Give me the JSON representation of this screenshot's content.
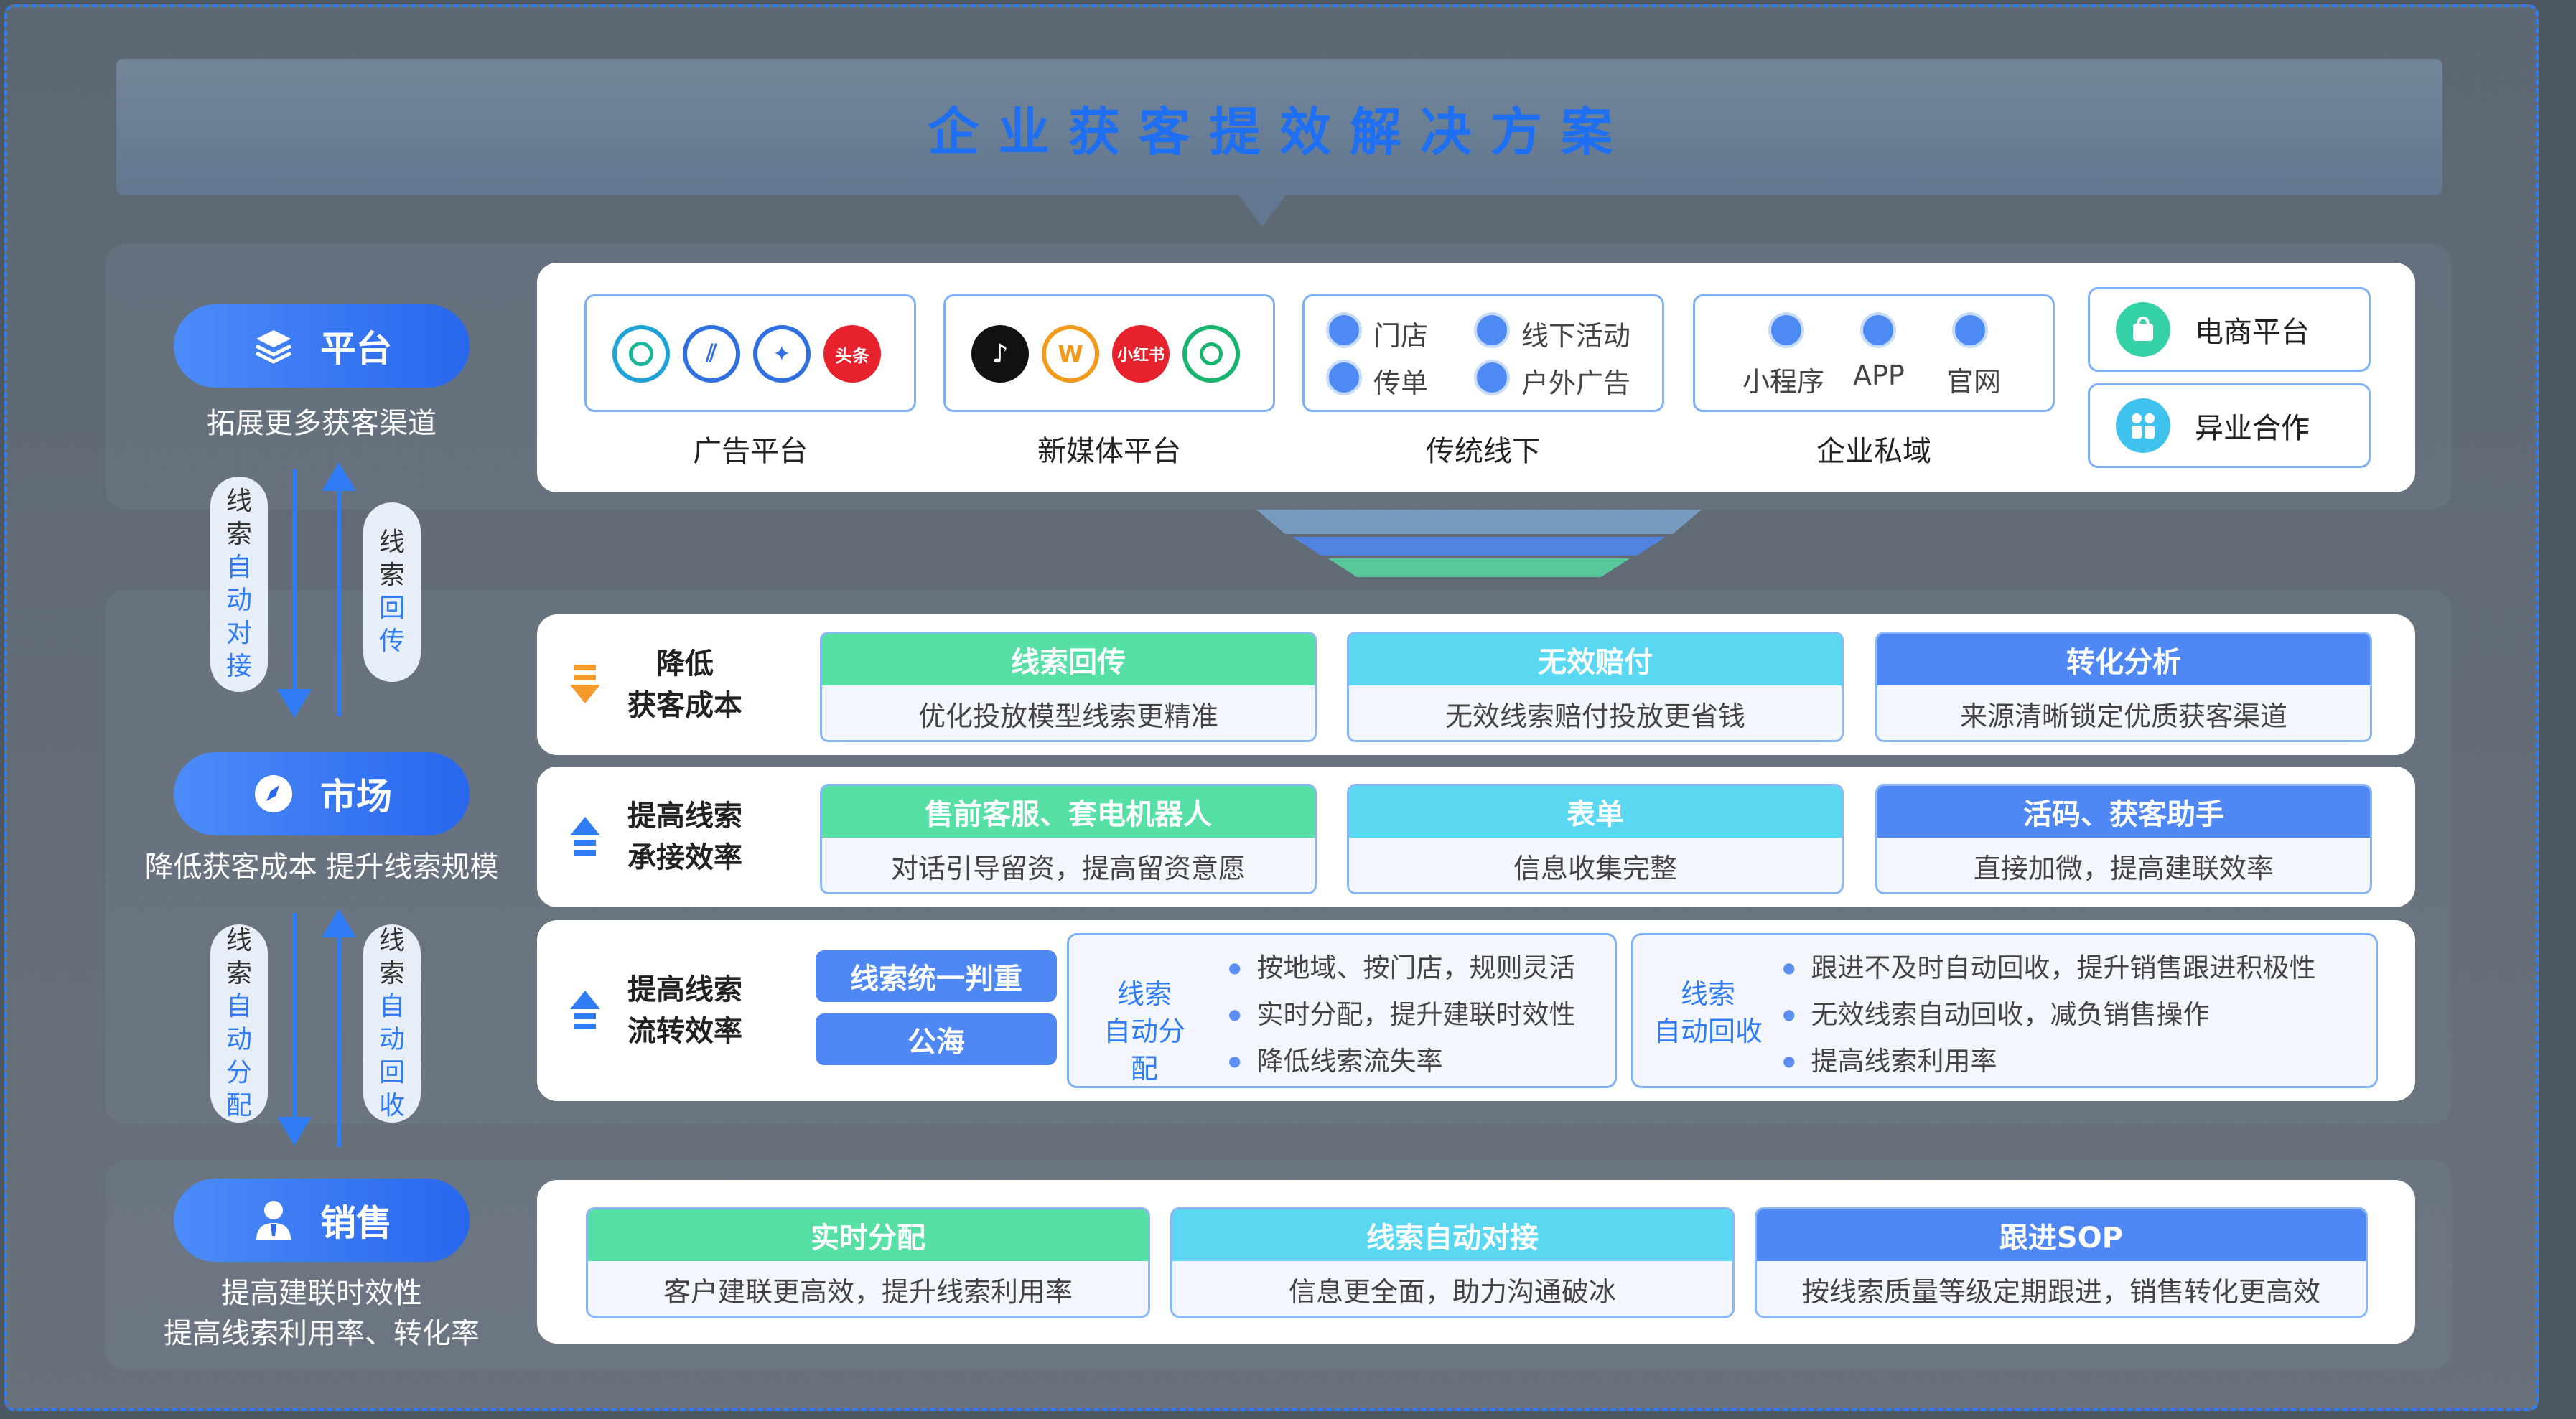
{
  "title": "企业获客提效解决方案",
  "stages": {
    "platform": {
      "label": "平台",
      "sub": "拓展更多获客渠道"
    },
    "market": {
      "label": "市场",
      "sub": "降低获客成本 提升线索规模"
    },
    "sales": {
      "label": "销售",
      "sub1": "提高建联时效性",
      "sub2": "提高线索利用率、转化率"
    }
  },
  "flows": {
    "f1": [
      "线",
      "索",
      "自",
      "动",
      "对",
      "接"
    ],
    "f2": [
      "线",
      "索",
      "回",
      "传"
    ],
    "f3": [
      "线",
      "索",
      "自",
      "动",
      "分",
      "配"
    ],
    "f4": [
      "线",
      "索",
      "自",
      "动",
      "回",
      "收"
    ]
  },
  "channels": {
    "ad": {
      "label": "广告平台",
      "logos": [
        "",
        "",
        "",
        "头条"
      ]
    },
    "media": {
      "label": "新媒体平台",
      "logos": [
        "",
        "",
        "小红书",
        ""
      ]
    },
    "offline": {
      "label": "传统线下",
      "items": [
        "门店",
        "线下活动",
        "传单",
        "户外广告"
      ]
    },
    "private": {
      "label": "企业私域",
      "items": [
        "小程序",
        "APP",
        "官网"
      ]
    },
    "ecommerce": "电商平台",
    "crossover": "异业合作"
  },
  "market_rows": [
    {
      "label1": "降低",
      "label2": "获客成本",
      "cards": [
        {
          "title": "线索回传",
          "desc": "优化投放模型线索更精准"
        },
        {
          "title": "无效赔付",
          "desc": "无效线索赔付投放更省钱"
        },
        {
          "title": "转化分析",
          "desc": "来源清晰锁定优质获客渠道"
        }
      ]
    },
    {
      "label1": "提高线索",
      "label2": "承接效率",
      "cards": [
        {
          "title": "售前客服、套电机器人",
          "desc": "对话引导留资，提高留资意愿"
        },
        {
          "title": "表单",
          "desc": "信息收集完整"
        },
        {
          "title": "活码、获客助手",
          "desc": "直接加微，提高建联效率"
        }
      ]
    },
    {
      "label1": "提高线索",
      "label2": "流转效率",
      "buttons": [
        "线索统一判重",
        "公海"
      ],
      "assign": {
        "l1": "线索",
        "l2": "自动分配",
        "bullets": [
          "按地域、按门店，规则灵活",
          "实时分配，提升建联时效性",
          "降低线索流失率"
        ]
      },
      "recycle": {
        "l1": "线索",
        "l2": "自动回收",
        "bullets": [
          "跟进不及时自动回收，提升销售跟进积极性",
          "无效线索自动回收，减负销售操作",
          "提高线索利用率"
        ]
      }
    }
  ],
  "sales_cards": [
    {
      "title": "实时分配",
      "desc": "客户建联更高效，提升线索利用率"
    },
    {
      "title": "线索自动对接",
      "desc": "信息更全面，助力沟通破冰"
    },
    {
      "title": "跟进SOP",
      "desc": "按线索质量等级定期跟进，销售转化更高效"
    }
  ],
  "colors": {
    "accent": "#2f7cf6",
    "green": "#56e0a5",
    "cyan": "#5ad8f2",
    "blue": "#4f88f5"
  }
}
